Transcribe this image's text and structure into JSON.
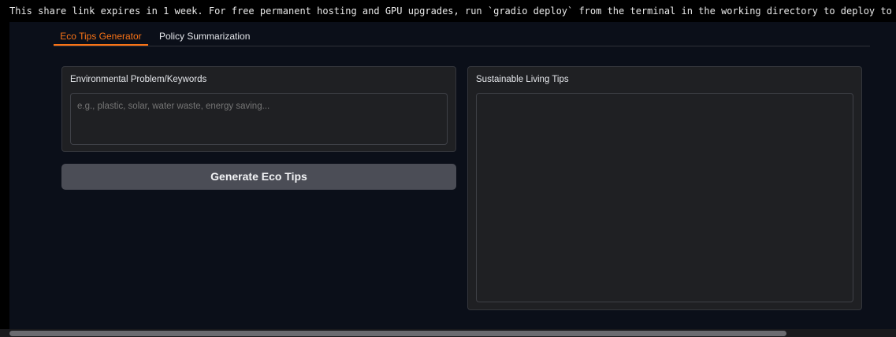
{
  "terminal_banner": {
    "text": "This share link expires in 1 week. For free permanent hosting and GPU upgrades, run `gradio deploy` from the terminal in the working directory to deploy to Hugging Face Sp"
  },
  "tabs": [
    {
      "label": "Eco Tips Generator",
      "active": true
    },
    {
      "label": "Policy Summarization",
      "active": false
    }
  ],
  "input_panel": {
    "label": "Environmental Problem/Keywords",
    "placeholder": "e.g., plastic, solar, water waste, energy saving...",
    "value": ""
  },
  "generate_button": {
    "label": "Generate Eco Tips"
  },
  "output_panel": {
    "label": "Sustainable Living Tips",
    "value": ""
  },
  "colors": {
    "accent": "#f97316",
    "background": "#0b0f19",
    "panel": "#1f2023",
    "button": "#4b4d56"
  }
}
